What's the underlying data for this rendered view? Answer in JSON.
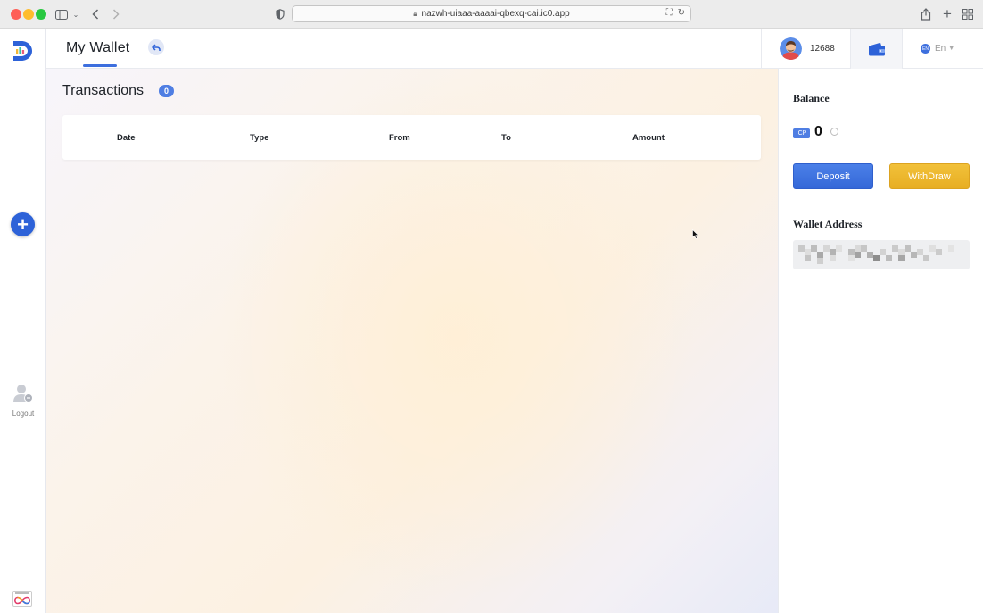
{
  "browser": {
    "url": "nazwh-uiaaa-aaaai-qbexq-cai.ic0.app"
  },
  "header": {
    "title": "My Wallet",
    "user_id": "12688",
    "language": "En",
    "language_flag": "EN"
  },
  "sidebar": {
    "logout_label": "Logout"
  },
  "transactions": {
    "title": "Transactions",
    "count": "0",
    "columns": [
      "Date",
      "Type",
      "From",
      "To",
      "Amount"
    ]
  },
  "wallet": {
    "balance_label": "Balance",
    "currency": "ICP",
    "balance": "0",
    "deposit_label": "Deposit",
    "withdraw_label": "WithDraw",
    "address_label": "Wallet Address"
  },
  "colors": {
    "accent": "#2d62d8",
    "deposit": "#3d6fde",
    "withdraw": "#ebb42a"
  }
}
